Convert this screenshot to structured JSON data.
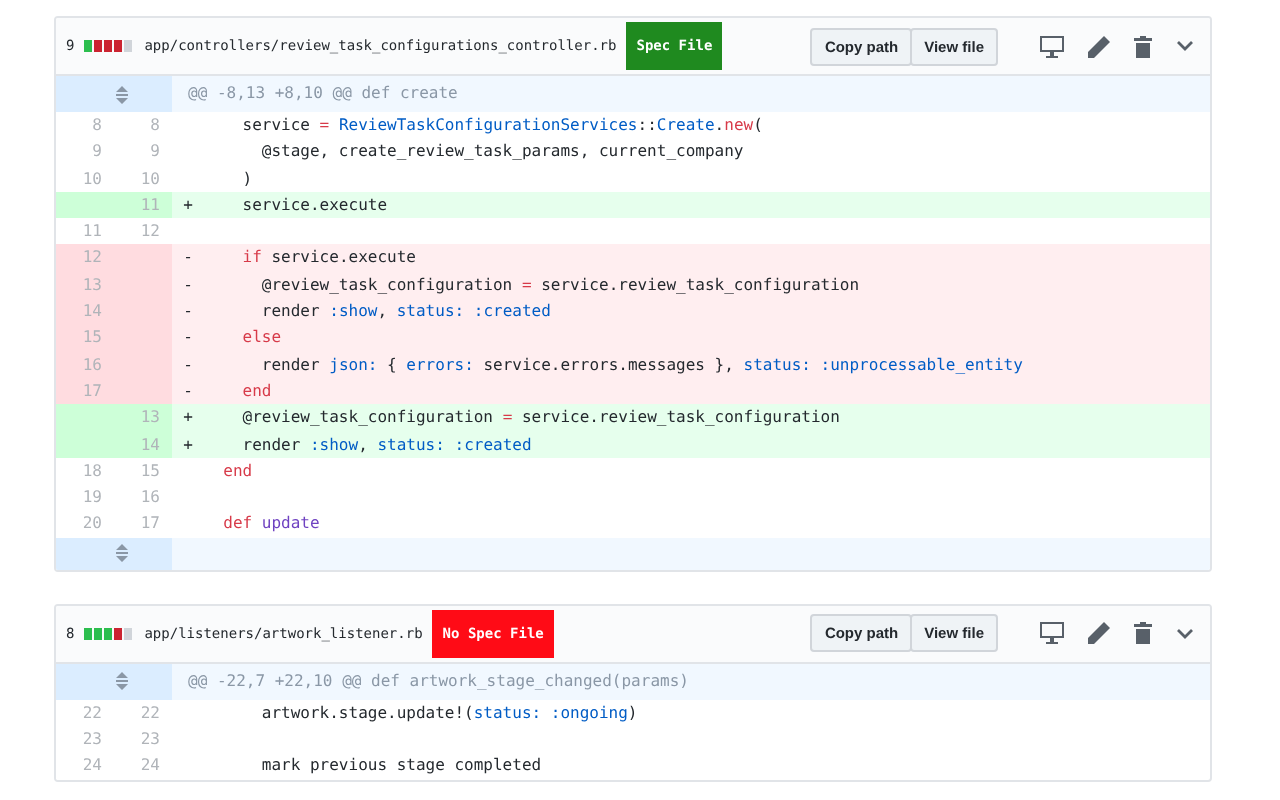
{
  "files": [
    {
      "changes": "9",
      "diffstat": [
        {
          "color": "#2cbe4e"
        },
        {
          "color": "#cb2431"
        },
        {
          "color": "#cb2431"
        },
        {
          "color": "#cb2431"
        },
        {
          "color": "#d1d5da"
        }
      ],
      "path": "app/controllers/review_task_configurations_controller.rb",
      "badge": {
        "text": "Spec File",
        "kind": "ok"
      },
      "actions": [
        "Copy path",
        "View file"
      ],
      "rows": [
        {
          "kind": "hunk",
          "text": "@@ -8,13 +8,10 @@ def create"
        },
        {
          "kind": "context",
          "old": "8",
          "new": "8",
          "code": [
            {
              "kind": "plain",
              "text": "    service "
            },
            {
              "kind": "keyword",
              "text": "="
            },
            {
              "kind": "constant",
              "text": " ReviewTaskConfigurationServices"
            },
            {
              "kind": "plain",
              "text": "::"
            },
            {
              "kind": "constant",
              "text": "Create"
            },
            {
              "kind": "plain",
              "text": "."
            },
            {
              "kind": "keyword",
              "text": "new"
            },
            {
              "kind": "plain",
              "text": "("
            }
          ]
        },
        {
          "kind": "context",
          "old": "9",
          "new": "9",
          "code": [
            {
              "kind": "plain",
              "text": "      @stage, create_review_task_params, current_company"
            }
          ]
        },
        {
          "kind": "context",
          "old": "10",
          "new": "10",
          "code": [
            {
              "kind": "plain",
              "text": "    )"
            }
          ]
        },
        {
          "kind": "added",
          "new": "11",
          "sign": "+",
          "code": [
            {
              "kind": "plain",
              "text": "    service.execute"
            }
          ]
        },
        {
          "kind": "context",
          "old": "11",
          "new": "12",
          "code": []
        },
        {
          "kind": "removed",
          "old": "12",
          "sign": "-",
          "code": [
            {
              "kind": "keyword",
              "text": "    if"
            },
            {
              "kind": "plain",
              "text": " service.execute"
            }
          ]
        },
        {
          "kind": "removed",
          "old": "13",
          "sign": "-",
          "code": [
            {
              "kind": "plain",
              "text": "      @review_task_configuration "
            },
            {
              "kind": "keyword",
              "text": "="
            },
            {
              "kind": "plain",
              "text": " service.review_task_configuration"
            }
          ]
        },
        {
          "kind": "removed",
          "old": "14",
          "sign": "-",
          "code": [
            {
              "kind": "plain",
              "text": "      render "
            },
            {
              "kind": "constant",
              "text": ":show"
            },
            {
              "kind": "plain",
              "text": ", "
            },
            {
              "kind": "constant",
              "text": "status: :created"
            }
          ]
        },
        {
          "kind": "removed",
          "old": "15",
          "sign": "-",
          "code": [
            {
              "kind": "keyword",
              "text": "    else"
            }
          ]
        },
        {
          "kind": "removed",
          "old": "16",
          "sign": "-",
          "code": [
            {
              "kind": "plain",
              "text": "      render "
            },
            {
              "kind": "constant",
              "text": "json:"
            },
            {
              "kind": "plain",
              "text": " { "
            },
            {
              "kind": "constant",
              "text": "errors:"
            },
            {
              "kind": "plain",
              "text": " service.errors.messages }, "
            },
            {
              "kind": "constant",
              "text": "status: :unprocessable_entity"
            }
          ]
        },
        {
          "kind": "removed",
          "old": "17",
          "sign": "-",
          "code": [
            {
              "kind": "keyword",
              "text": "    end"
            }
          ]
        },
        {
          "kind": "added",
          "new": "13",
          "sign": "+",
          "code": [
            {
              "kind": "plain",
              "text": "    @review_task_configuration "
            },
            {
              "kind": "keyword",
              "text": "="
            },
            {
              "kind": "plain",
              "text": " service.review_task_configuration"
            }
          ]
        },
        {
          "kind": "added",
          "new": "14",
          "sign": "+",
          "code": [
            {
              "kind": "plain",
              "text": "    render "
            },
            {
              "kind": "constant",
              "text": ":show"
            },
            {
              "kind": "plain",
              "text": ", "
            },
            {
              "kind": "constant",
              "text": "status: :created"
            }
          ]
        },
        {
          "kind": "context",
          "old": "18",
          "new": "15",
          "code": [
            {
              "kind": "keyword",
              "text": "  end"
            }
          ]
        },
        {
          "kind": "context",
          "old": "19",
          "new": "16",
          "code": []
        },
        {
          "kind": "context",
          "old": "20",
          "new": "17",
          "code": [
            {
              "kind": "keyword",
              "text": "  def"
            },
            {
              "kind": "method",
              "text": " update"
            }
          ]
        },
        {
          "kind": "expand"
        }
      ]
    },
    {
      "changes": "8",
      "diffstat": [
        {
          "color": "#2cbe4e"
        },
        {
          "color": "#2cbe4e"
        },
        {
          "color": "#2cbe4e"
        },
        {
          "color": "#cb2431"
        },
        {
          "color": "#d1d5da"
        }
      ],
      "path": "app/listeners/artwork_listener.rb",
      "badge": {
        "text": "No Spec File",
        "kind": "missing"
      },
      "actions": [
        "Copy path",
        "View file"
      ],
      "rows": [
        {
          "kind": "hunk",
          "text": "@@ -22,7 +22,10 @@ def artwork_stage_changed(params)"
        },
        {
          "kind": "context",
          "old": "22",
          "new": "22",
          "code": [
            {
              "kind": "plain",
              "text": "      artwork.stage.update!("
            },
            {
              "kind": "constant",
              "text": "status: :ongoing"
            },
            {
              "kind": "plain",
              "text": ")"
            }
          ]
        },
        {
          "kind": "context",
          "old": "23",
          "new": "23",
          "code": []
        },
        {
          "kind": "context",
          "old": "24",
          "new": "24",
          "code": [
            {
              "kind": "plain",
              "text": "      mark previous stage completed"
            }
          ]
        }
      ]
    }
  ]
}
